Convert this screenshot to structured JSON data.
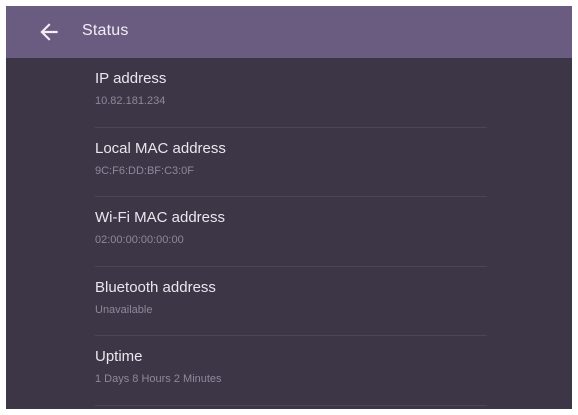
{
  "appbar": {
    "title": "Status",
    "back_icon": "arrow-left-icon"
  },
  "items": [
    {
      "title": "IP address",
      "value": "10.82.181.234"
    },
    {
      "title": "Local MAC address",
      "value": "9C:F6:DD:BF:C3:0F"
    },
    {
      "title": "Wi-Fi MAC address",
      "value": "02:00:00:00:00:00"
    },
    {
      "title": "Bluetooth address",
      "value": "Unavailable"
    },
    {
      "title": "Uptime",
      "value": "1 Days 8 Hours 2 Minutes"
    }
  ],
  "colors": {
    "appbar_bg": "#6a5c80",
    "screen_bg": "#3c3646",
    "primary_text": "#e9e6ee",
    "secondary_text": "#8f889b"
  }
}
